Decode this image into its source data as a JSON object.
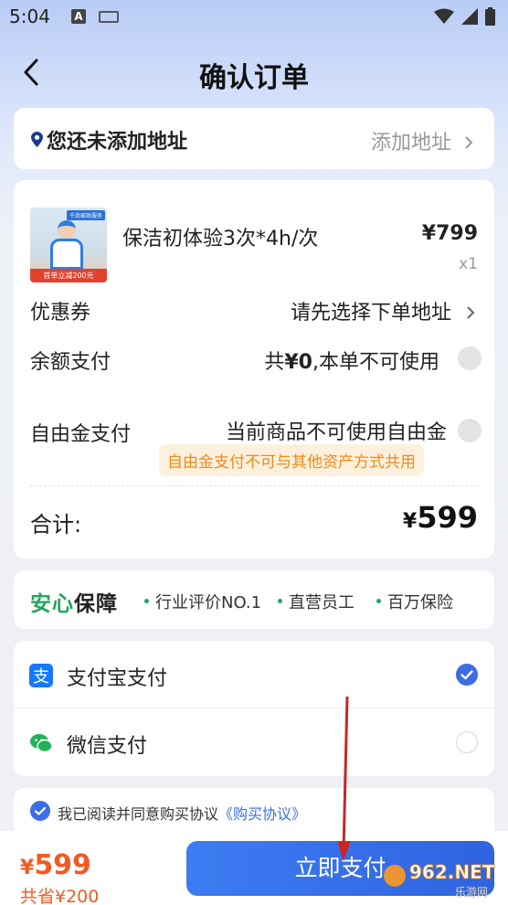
{
  "status": {
    "time": "5:04",
    "a_icon": "A"
  },
  "nav": {
    "title": "确认订单"
  },
  "address": {
    "text": "您还未添加地址",
    "action": "添加地址"
  },
  "product": {
    "thumb_top": "千尚家政服务",
    "thumb_bottom": "首单立减200元",
    "name": "保洁初体验3次*4h/次",
    "price": "¥799",
    "qty": "x1"
  },
  "coupon": {
    "label": "优惠券",
    "value": "请先选择下单地址"
  },
  "balance": {
    "label": "余额支付",
    "note_prefix": "共",
    "amount": "¥0",
    "note_suffix": ",本单不可使用"
  },
  "free_fund": {
    "label": "自由金支付",
    "note": "当前商品不可使用自由金",
    "tip": "自由金支付不可与其他资产方式共用"
  },
  "total": {
    "label": "合计:",
    "currency": "¥",
    "amount": "599"
  },
  "guarantee": {
    "title_part1": "安心",
    "title_part2": "保障",
    "items": [
      "行业评价NO.1",
      "直营员工",
      "百万保险"
    ]
  },
  "payment": {
    "methods": [
      {
        "label": "支付宝支付",
        "selected": true,
        "icon": "alipay-icon"
      },
      {
        "label": "微信支付",
        "selected": false,
        "icon": "wechat-icon"
      }
    ]
  },
  "agreement": {
    "text": "我已阅读并同意购买协议",
    "link": "《购买协议》"
  },
  "bottom": {
    "currency": "¥",
    "amount": "599",
    "saved": "共省¥200",
    "button": "立即支付"
  },
  "watermark": {
    "text": "962.NET",
    "sub": "乐游网"
  },
  "colors": {
    "accent": "#3b6de3",
    "price": "#f15a24",
    "guarantee_green": "#21a55c",
    "tip_bg": "#fdf0dc",
    "tip_text": "#f08a1a"
  }
}
